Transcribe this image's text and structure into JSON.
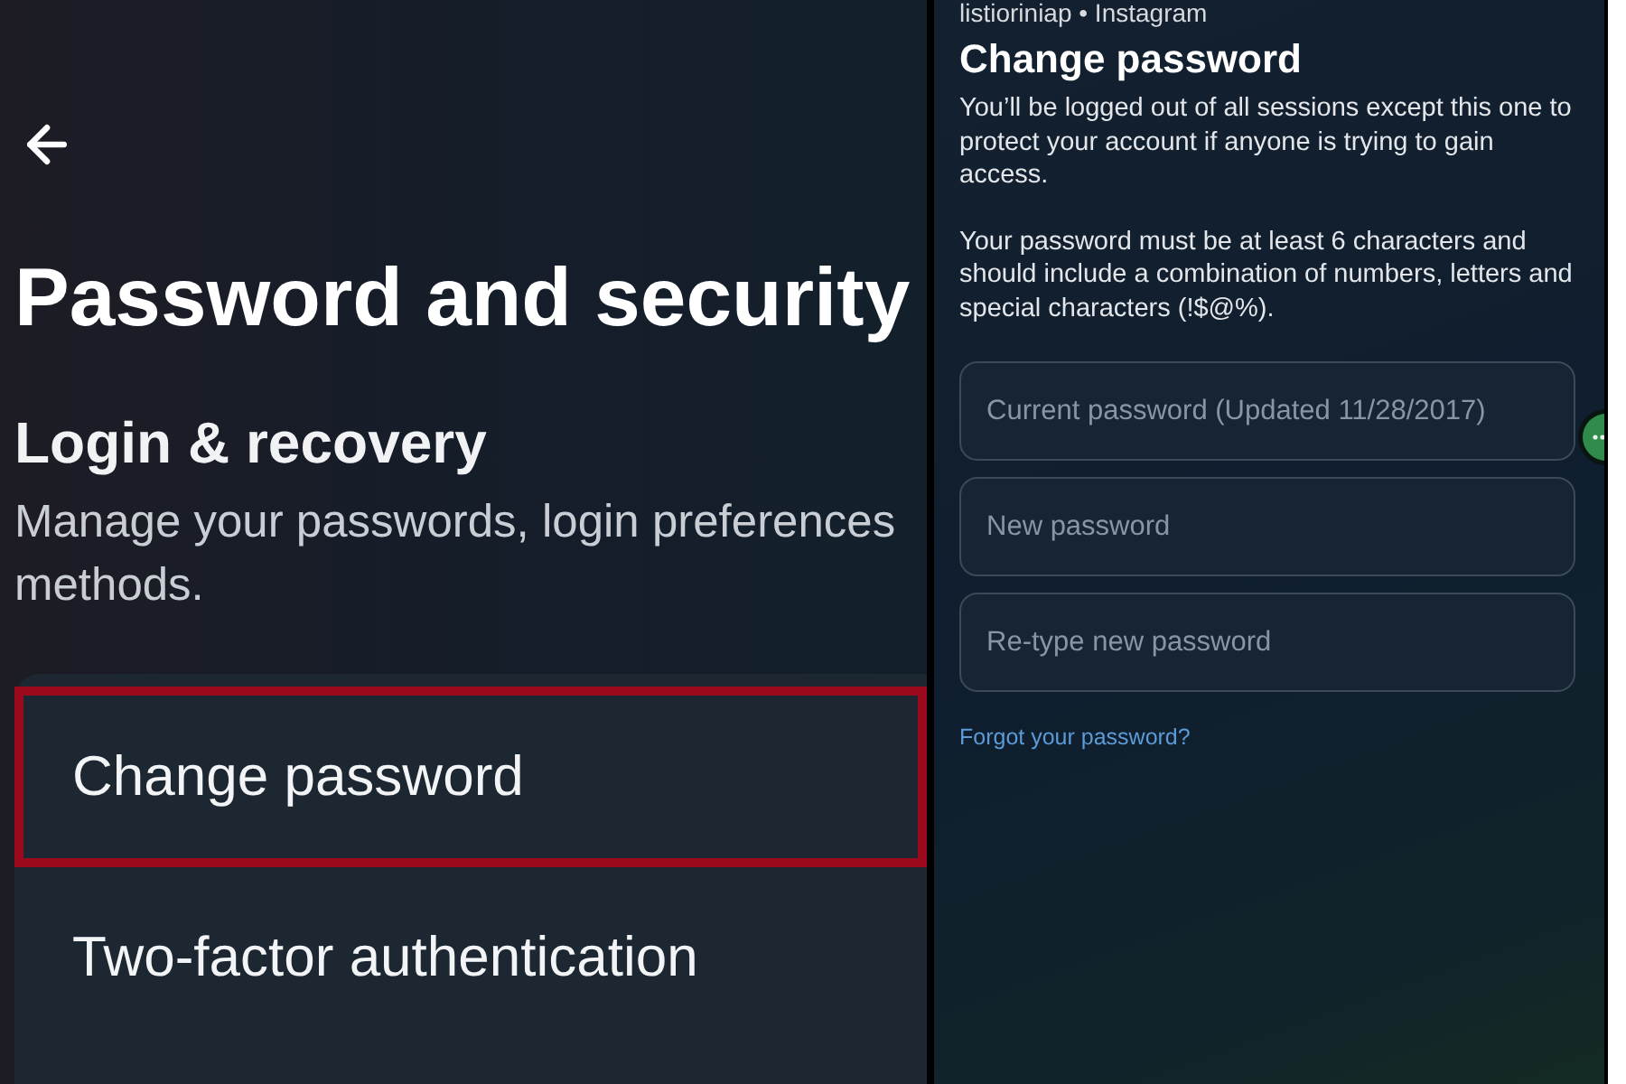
{
  "settings_panel": {
    "title": "Password and security",
    "section": {
      "heading": "Login & recovery",
      "description_lines": [
        "Manage your passwords, login preferences",
        "methods."
      ]
    },
    "items": [
      {
        "label": "Change password",
        "highlighted": true
      },
      {
        "label": "Two-factor authentication",
        "highlighted": false
      }
    ]
  },
  "change_password_panel": {
    "account_line": "listioriniap • Instagram",
    "title": "Change password",
    "paragraphs": [
      "You’ll be logged out of all sessions except this one to protect your account if anyone is trying to gain access.",
      "Your password must be at least 6 characters and should include a combination of numbers, letters and special characters (!$@%)."
    ],
    "fields": [
      {
        "placeholder": "Current password (Updated 11/28/2017)"
      },
      {
        "placeholder": "New password"
      },
      {
        "placeholder": "Re-type new password"
      }
    ],
    "link": "Forgot your password?"
  }
}
